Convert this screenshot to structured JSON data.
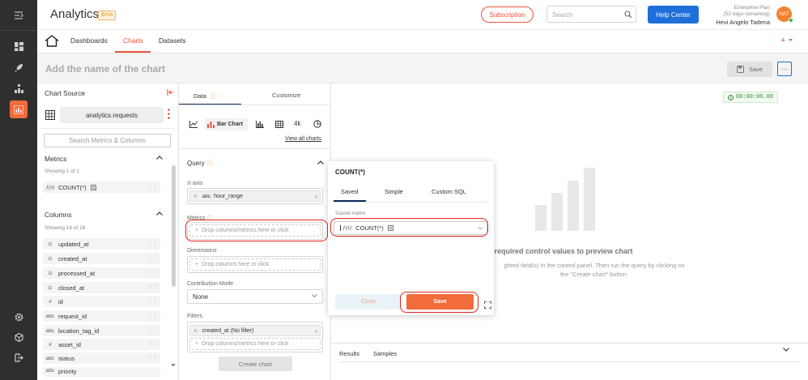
{
  "app": {
    "title": "Analytics",
    "beta_badge": "Beta",
    "subscription_label": "Subscription",
    "search_placeholder": "Search",
    "help_center_label": "Help Center",
    "plan_name": "Enterprise Plan",
    "plan_days": "(52 days remaining)",
    "user_name": "Hevi Angelo Tadena",
    "user_initials": "HAT"
  },
  "nav": {
    "dashboards": "Dashboards",
    "charts": "Charts",
    "datasets": "Datasets",
    "plus": "+"
  },
  "titlebar": {
    "chart_name_placeholder": "Add the name of the chart",
    "save_label": "Save",
    "more_label": "⋯"
  },
  "source": {
    "title": "Chart Source",
    "dataset": "analytics.requests",
    "search_placeholder": "Search Metrics & Columns",
    "metrics_title": "Metrics",
    "metrics_count": "Showing 1 of 1",
    "metrics": [
      {
        "icon": "ƒ(x)",
        "name": "COUNT(*)"
      }
    ],
    "columns_title": "Columns",
    "columns_count": "Showing 18 of 18",
    "columns": [
      {
        "icon": "⊙",
        "name": "updated_at"
      },
      {
        "icon": "⊙",
        "name": "created_at"
      },
      {
        "icon": "⊙",
        "name": "processed_at"
      },
      {
        "icon": "⊙",
        "name": "closed_at"
      },
      {
        "icon": "#",
        "name": "id"
      },
      {
        "icon": "abc",
        "name": "request_id"
      },
      {
        "icon": "abc",
        "name": "location_tag_id"
      },
      {
        "icon": "#",
        "name": "asset_id"
      },
      {
        "icon": "abc",
        "name": "status"
      },
      {
        "icon": "abc",
        "name": "priority"
      }
    ]
  },
  "data_panel": {
    "tab_data": "Data",
    "tab_customize": "Customize",
    "chart_type_selected": "Bar Chart",
    "big_number_label": "4k",
    "view_all": "View all charts",
    "query_title": "Query",
    "xaxis_label": "X-axis",
    "xaxis_value_type": "abc",
    "xaxis_value": "hour_range",
    "metrics_label": "Metrics",
    "metrics_placeholder": "Drop columns/metrics here or click",
    "dimensions_label": "Dimensions",
    "dimensions_placeholder": "Drop columns here or click",
    "contribution_label": "Contribution Mode",
    "contribution_value": "None",
    "filters_label": "Filters",
    "filter_value": "created_at (No filter)",
    "filters_placeholder": "Drop columns/metrics here or click",
    "create_chart": "Create chart"
  },
  "preview": {
    "timer": "00:00:00.00",
    "empty_title": "dd required control values to preview chart",
    "empty_desc_1": "ghted field(s) in the control panel. Then run the query by clicking on",
    "empty_desc_2": "the \"Create chart\" button.",
    "tab_results": "Results",
    "tab_samples": "Samples"
  },
  "popover": {
    "title": "COUNT(*)",
    "tab_saved": "Saved",
    "tab_simple": "Simple",
    "tab_custom_sql": "Custom SQL",
    "saved_metric_label": "Saved metric",
    "saved_metric_icon": "ƒ(x)",
    "saved_metric_value": "COUNT(*)",
    "close_label": "Close",
    "save_label": "Save"
  },
  "colors": {
    "accent": "#f26b3a",
    "primary": "#1e6fd9",
    "nav_bg": "#2f2f2f",
    "highlight": "#e0281c"
  }
}
